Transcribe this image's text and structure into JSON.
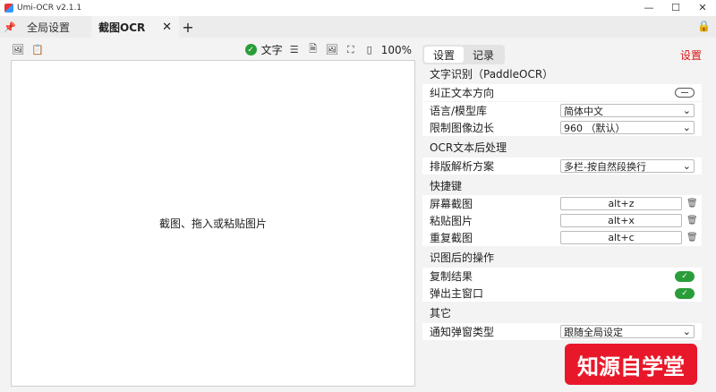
{
  "window": {
    "title": "Umi-OCR v2.1.1",
    "controls": [
      "—",
      "☐",
      "✕"
    ]
  },
  "tabs": {
    "global": "全局设置",
    "active": "截图OCR",
    "close": "✕",
    "add": "+"
  },
  "toolbar": {
    "text_label": "文字",
    "zoom": "100%"
  },
  "canvas": {
    "hint": "截图、拖入或粘贴图片"
  },
  "panel": {
    "tab_settings": "设置",
    "tab_records": "记录",
    "settings_link": "设置",
    "sections": {
      "ocr": "文字识别（PaddleOCR）",
      "post": "OCR文本后处理",
      "hotkeys": "快捷键",
      "after": "识图后的操作",
      "other": "其它"
    },
    "rows": {
      "correct_direction": "纠正文本方向",
      "language": "语言/模型库",
      "language_value": "简体中文",
      "limit_side": "限制图像边长",
      "limit_side_value": "960 （默认）",
      "layout": "排版解析方案",
      "layout_value": "多栏-按自然段换行",
      "screenshot": "屏幕截图",
      "screenshot_key": "alt+z",
      "paste": "粘贴图片",
      "paste_key": "alt+x",
      "repeat": "重复截图",
      "repeat_key": "alt+c",
      "copy_result": "复制结果",
      "popup_main": "弹出主窗口",
      "notify_type": "通知弹窗类型",
      "notify_value": "跟随全局设定"
    },
    "toggles": {
      "correct_direction": false,
      "copy_result": true,
      "popup_main": true
    }
  },
  "watermark": {
    "text": "知源自学堂"
  },
  "colors": {
    "accent_green": "#2a9d3a",
    "settings_red": "#d11111",
    "watermark_red": "#e8182a"
  }
}
